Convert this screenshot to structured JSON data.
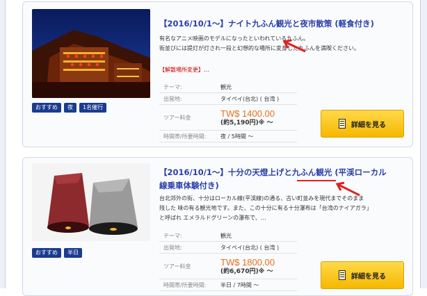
{
  "tours": [
    {
      "title": "【2016/10/1〜】ナイト九ふん観光と夜市散策 (軽食付き)",
      "desc_lines": [
        "有名なアニメ映画のモデルになったといわれている九ふん。",
        "街並びには提灯が灯され一段と幻想的な場所に変身した九ふんを満喫ください。"
      ],
      "venue_change": "【解散場所変更】",
      "venue_suffix": "…",
      "tags": [
        "おすすめ",
        "夜",
        "1名催行"
      ],
      "info": {
        "theme_label": "テーマ:",
        "theme": "観光",
        "origin_label": "出発地:",
        "origin": "タイペイ(台北) ( 台湾 )",
        "fee_label": "ツアー料金",
        "price": "TW$ 1400.00",
        "price_jpy": "(約5,190円)※ 〜",
        "time_label": "時間帯/所要時間:",
        "time": "夜 / 5時間 〜"
      },
      "button": "詳細を見る"
    },
    {
      "title_line1": "【2016/10/1〜】十分の天燈上げと九ふん観光 (平渓ローカル",
      "title_line2": "線乗車体験付き)",
      "desc_lines": [
        "台北郊外の街、十分はローカル線(平渓線)の通る、古い町並みを現代までそのまま",
        "残した 味の有る観光地です。また、この十分に有る十分瀑布は「台湾のナイアガラ」",
        "と呼ばれ エメラルドグリーンの瀑布で、…"
      ],
      "tags": [
        "おすすめ",
        "半日"
      ],
      "info": {
        "theme_label": "テーマ:",
        "theme": "観光",
        "origin_label": "出発地:",
        "origin": "タイペイ(台北) ( 台湾 )",
        "fee_label": "ツアー料金",
        "price": "TW$ 1800.00",
        "price_jpy": "(約6,670円)※ 〜",
        "time_label": "時間帯/所要時間:",
        "time": "半日 / 7時間 〜"
      },
      "button": "詳細を見る"
    }
  ],
  "colors": {
    "title": "#2a3fa8",
    "price": "#e8701a",
    "tag": "#1a3c8e",
    "button": "#f5b800",
    "annotation": "#e02020"
  }
}
